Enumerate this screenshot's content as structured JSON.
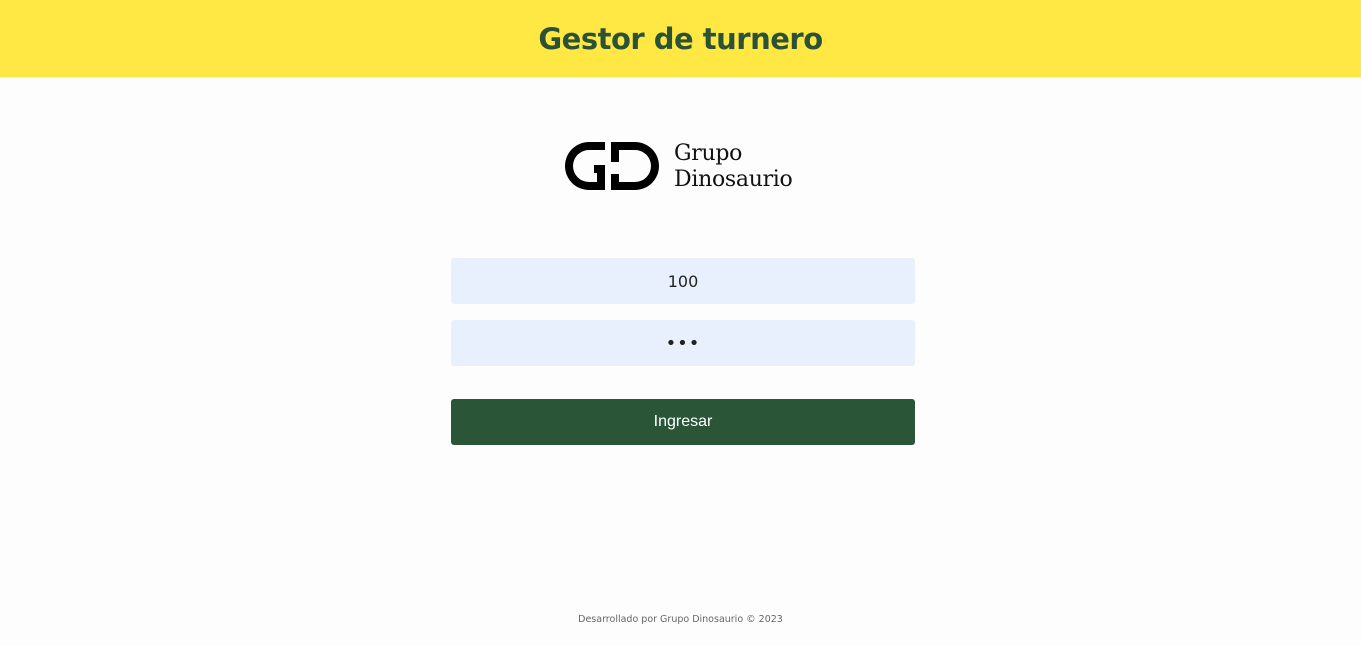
{
  "header": {
    "title": "Gestor de turnero",
    "background_color": "#ffe843",
    "title_color": "#2b5235"
  },
  "logo": {
    "line1": "Grupo",
    "line2": "Dinosaurio",
    "mark_letters": "GD"
  },
  "form": {
    "username_value": "100",
    "password_value": "***",
    "submit_label": "Ingresar",
    "submit_color": "#2a5637",
    "field_background": "#e8f0fd"
  },
  "footer": {
    "text": "Desarrollado por Grupo Dinosaurio © 2023"
  }
}
